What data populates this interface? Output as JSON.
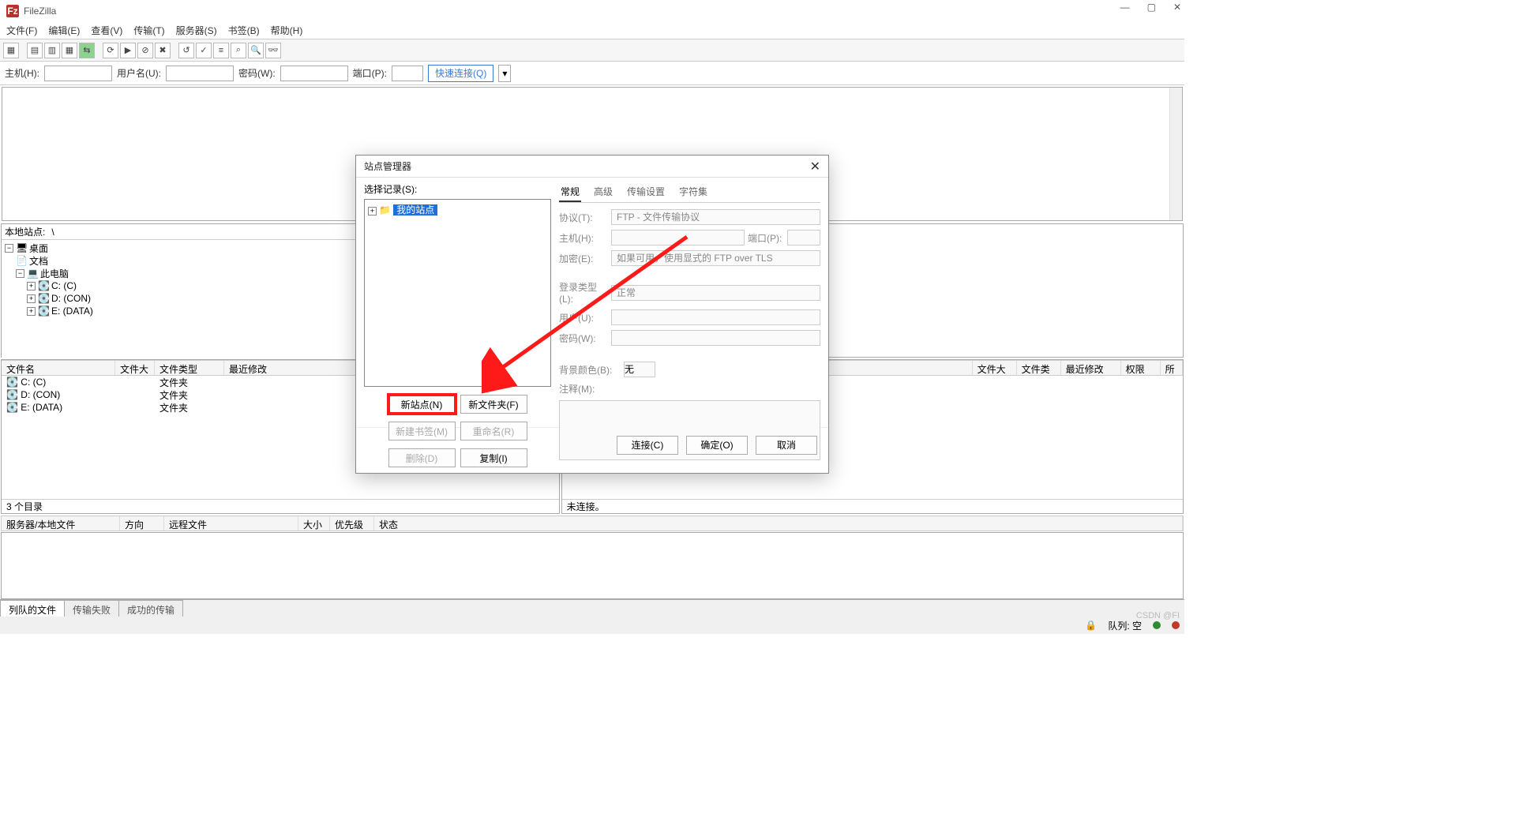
{
  "title": "FileZilla",
  "menus": {
    "file": "文件(F)",
    "edit": "编辑(E)",
    "view": "查看(V)",
    "transfer": "传输(T)",
    "server": "服务器(S)",
    "bookmarks": "书签(B)",
    "help": "帮助(H)"
  },
  "quick": {
    "host": "主机(H):",
    "user": "用户名(U):",
    "pass": "密码(W):",
    "port": "端口(P):",
    "btn": "快速连接(Q)"
  },
  "localpath": {
    "label": "本地站点:",
    "value": "\\"
  },
  "tree": {
    "desktop": "桌面",
    "docs": "文档",
    "pc": "此电脑",
    "c": "C: (C)",
    "d": "D: (CON)",
    "e": "E: (DATA)"
  },
  "cols": {
    "name": "文件名",
    "size": "文件大小",
    "type": "文件类型",
    "mtime": "最近修改",
    "rsize": "文件大小",
    "rtype": "文件类型",
    "rmtime": "最近修改",
    "perm": "权限",
    "owner": "所有者/组"
  },
  "rows": {
    "c": {
      "name": "C: (C)",
      "type": "文件夹"
    },
    "d": {
      "name": "D: (CON)",
      "type": "文件夹"
    },
    "e": {
      "name": "E: (DATA)",
      "type": "文件夹"
    }
  },
  "status": {
    "local": "3 个目录",
    "remote": "未连接。"
  },
  "queuecols": {
    "server": "服务器/本地文件",
    "dir": "方向",
    "remote": "远程文件",
    "size": "大小",
    "prio": "优先级",
    "state": "状态"
  },
  "tabs": {
    "queue": "列队的文件",
    "failed": "传输失败",
    "success": "成功的传输"
  },
  "bottom": {
    "queue": "队列: 空",
    "watermark": "CSDN @FI"
  },
  "dialog": {
    "title": "站点管理器",
    "select": "选择记录(S):",
    "mysites": "我的站点",
    "btns": {
      "newsite": "新站点(N)",
      "newfolder": "新文件夹(F)",
      "newbm": "新建书签(M)",
      "rename": "重命名(R)",
      "delete": "删除(D)",
      "copy": "复制(I)"
    },
    "tabs": {
      "general": "常规",
      "advanced": "高级",
      "transfer": "传输设置",
      "charset": "字符集"
    },
    "fields": {
      "protocol": {
        "label": "协议(T):",
        "value": "FTP - 文件传输协议"
      },
      "host": {
        "label": "主机(H):",
        "portlabel": "端口(P):"
      },
      "enc": {
        "label": "加密(E):",
        "value": "如果可用，使用显式的 FTP over TLS"
      },
      "logintype": {
        "label": "登录类型(L):",
        "value": "正常"
      },
      "user": {
        "label": "用户(U):"
      },
      "pass": {
        "label": "密码(W):"
      },
      "bgcolor": {
        "label": "背景颜色(B):",
        "value": "无"
      },
      "comment": {
        "label": "注释(M):"
      }
    },
    "foot": {
      "connect": "连接(C)",
      "ok": "确定(O)",
      "cancel": "取消"
    }
  }
}
